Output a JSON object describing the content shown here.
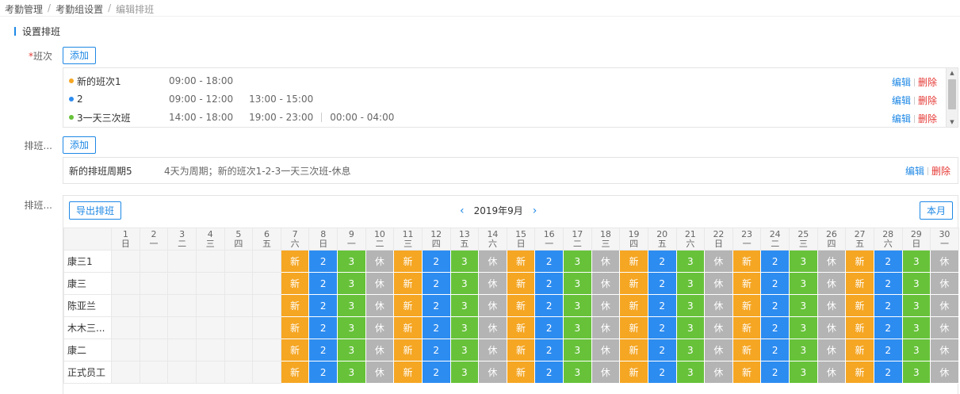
{
  "breadcrumb": [
    "考勤管理",
    "考勤组设置",
    "编辑排班"
  ],
  "section_title": "设置排班",
  "shift_label": "班次",
  "shift_add": "添加",
  "shifts": [
    {
      "name": "新的班次1",
      "color": "#f5a623",
      "times": [
        "09:00 - 18:00"
      ],
      "edit": "编辑",
      "delete": "删除"
    },
    {
      "name": "2",
      "color": "#2d8cf0",
      "times": [
        "09:00 - 12:00",
        "13:00 - 15:00"
      ],
      "edit": "编辑",
      "delete": "删除"
    },
    {
      "name": "3一天三次班",
      "color": "#67c23a",
      "times": [
        "14:00 - 18:00",
        "19:00 - 23:00",
        "00:00 - 04:00"
      ],
      "edit": "编辑",
      "delete": "删除"
    }
  ],
  "cycle_label": "排班...",
  "cycle_add": "添加",
  "cycle": {
    "name": "新的排班周期5",
    "desc": "4天为周期；新的班次1-2-3一天三次班-休息",
    "edit": "编辑",
    "delete": "删除"
  },
  "schedule_label": "排班...",
  "export_btn": "导出排班",
  "month": "2019年9月",
  "this_month_btn": "本月",
  "days": [
    {
      "d": "1",
      "w": "日"
    },
    {
      "d": "2",
      "w": "一"
    },
    {
      "d": "3",
      "w": "二"
    },
    {
      "d": "4",
      "w": "三"
    },
    {
      "d": "5",
      "w": "四"
    },
    {
      "d": "6",
      "w": "五"
    },
    {
      "d": "7",
      "w": "六"
    },
    {
      "d": "8",
      "w": "日"
    },
    {
      "d": "9",
      "w": "一"
    },
    {
      "d": "10",
      "w": "二"
    },
    {
      "d": "11",
      "w": "三"
    },
    {
      "d": "12",
      "w": "四"
    },
    {
      "d": "13",
      "w": "五"
    },
    {
      "d": "14",
      "w": "六"
    },
    {
      "d": "15",
      "w": "日"
    },
    {
      "d": "16",
      "w": "一"
    },
    {
      "d": "17",
      "w": "二"
    },
    {
      "d": "18",
      "w": "三"
    },
    {
      "d": "19",
      "w": "四"
    },
    {
      "d": "20",
      "w": "五"
    },
    {
      "d": "21",
      "w": "六"
    },
    {
      "d": "22",
      "w": "日"
    },
    {
      "d": "23",
      "w": "一"
    },
    {
      "d": "24",
      "w": "二"
    },
    {
      "d": "25",
      "w": "三"
    },
    {
      "d": "26",
      "w": "四"
    },
    {
      "d": "27",
      "w": "五"
    },
    {
      "d": "28",
      "w": "六"
    },
    {
      "d": "29",
      "w": "日"
    },
    {
      "d": "30",
      "w": "一"
    }
  ],
  "employees": [
    "康三1",
    "康三",
    "陈亚兰",
    "木木三...",
    "康二",
    "正式员工"
  ],
  "schedule_pattern": [
    "",
    "",
    "",
    "",
    "",
    "",
    "新",
    "2",
    "3",
    "休",
    "新",
    "2",
    "3",
    "休",
    "新",
    "2",
    "3",
    "休",
    "新",
    "2",
    "3",
    "休",
    "新",
    "2",
    "3",
    "休",
    "新",
    "2",
    "3",
    "休"
  ],
  "shift_colors": {
    "新": "#f5a623",
    "2": "#2d8cf0",
    "3": "#67c23a",
    "休": "#b4b4b4"
  }
}
